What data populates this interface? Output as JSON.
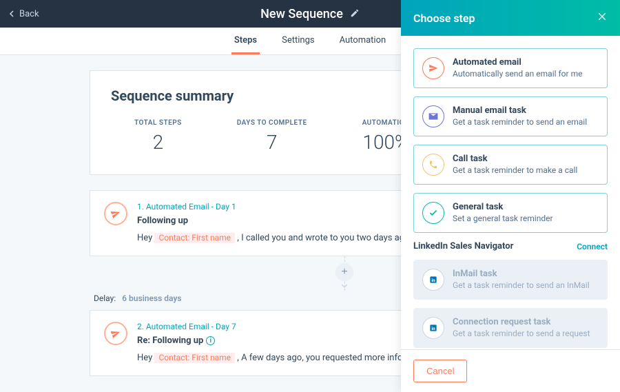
{
  "header": {
    "back_label": "Back",
    "title": "New Sequence"
  },
  "tabs": [
    {
      "label": "Steps",
      "active": true
    },
    {
      "label": "Settings",
      "active": false
    },
    {
      "label": "Automation",
      "active": false
    }
  ],
  "summary": {
    "title": "Sequence summary",
    "stats": [
      {
        "label": "TOTAL STEPS",
        "value": "2"
      },
      {
        "label": "DAYS TO COMPLETE",
        "value": "7"
      },
      {
        "label": "AUTOMATION",
        "value": "100%"
      }
    ]
  },
  "steps": [
    {
      "heading": "1. Automated Email - Day 1",
      "subject": "Following up",
      "preview_before": "Hey ",
      "token": "Contact: First name",
      "preview_after": " , I called you and wrote to you two days ago about some"
    },
    {
      "heading": "2. Automated Email - Day 7",
      "subject": "Re: Following up",
      "has_info": true,
      "preview_before": "Hey ",
      "token": "Contact: First name",
      "preview_after": " , A few days ago, you requested more information about"
    }
  ],
  "delay": {
    "label": "Delay:",
    "value": "6 business days"
  },
  "panel": {
    "title": "Choose step",
    "options": [
      {
        "icon": "send",
        "color": "#ff7a59",
        "title": "Automated email",
        "desc": "Automatically send an email for me",
        "disabled": false
      },
      {
        "icon": "envelope",
        "color": "#6a78d1",
        "title": "Manual email task",
        "desc": "Get a task reminder to send an email",
        "disabled": false
      },
      {
        "icon": "phone",
        "color": "#f5c26b",
        "title": "Call task",
        "desc": "Get a task reminder to make a call",
        "disabled": false
      },
      {
        "icon": "check",
        "color": "#00bda5",
        "title": "General task",
        "desc": "Set a general task reminder",
        "disabled": false
      }
    ],
    "linkedin": {
      "heading": "LinkedIn Sales Navigator",
      "connect": "Connect",
      "options": [
        {
          "icon": "linkedin",
          "color": "#0077b5",
          "title": "InMail task",
          "desc": "Get a task reminder to send an InMail"
        },
        {
          "icon": "linkedin",
          "color": "#0077b5",
          "title": "Connection request task",
          "desc": "Get a task reminder to send a request"
        }
      ]
    },
    "cancel": "Cancel"
  }
}
